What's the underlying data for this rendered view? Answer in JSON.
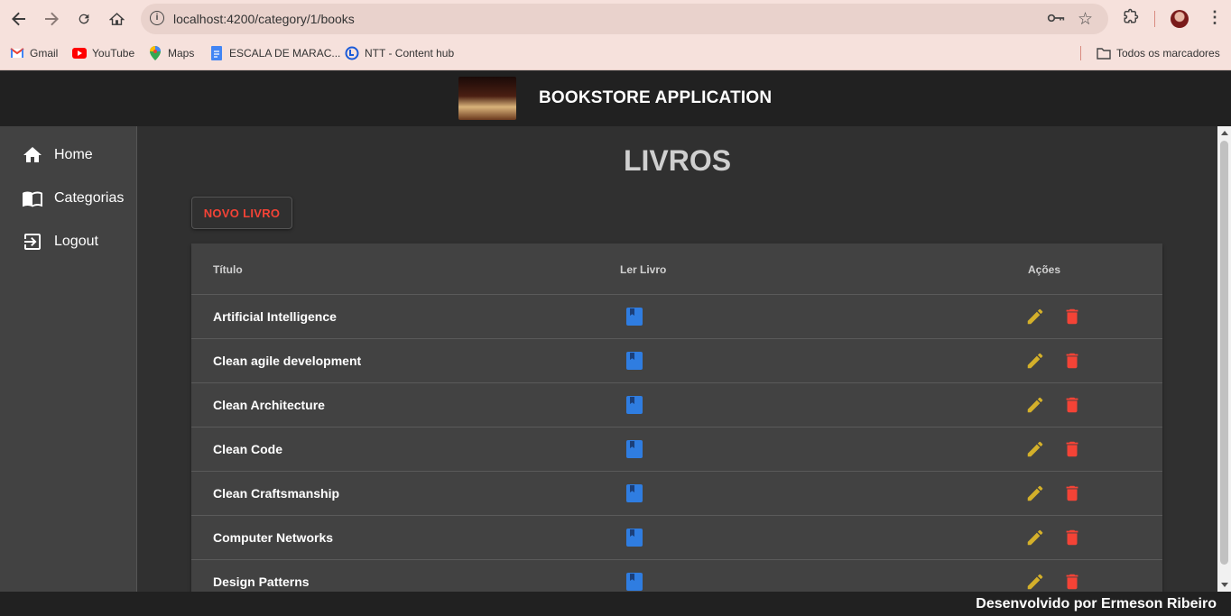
{
  "browser": {
    "url": "localhost:4200/category/1/books",
    "bookmarks": [
      {
        "label": "Gmail",
        "icon": "gmail-icon"
      },
      {
        "label": "YouTube",
        "icon": "youtube-icon"
      },
      {
        "label": "Maps",
        "icon": "maps-icon"
      },
      {
        "label": "ESCALA DE MARAC...",
        "icon": "docs-icon"
      },
      {
        "label": "NTT - Content hub",
        "icon": "ntt-icon"
      }
    ],
    "all_bookmarks_label": "Todos os marcadores"
  },
  "header": {
    "title": "BOOKSTORE APPLICATION"
  },
  "sidebar": {
    "items": [
      {
        "label": "Home",
        "icon": "home-icon"
      },
      {
        "label": "Categorias",
        "icon": "book-open-icon"
      },
      {
        "label": "Logout",
        "icon": "logout-icon"
      }
    ]
  },
  "main": {
    "title": "LIVROS",
    "new_button_label": "NOVO LIVRO",
    "table": {
      "headers": {
        "title": "Título",
        "read": "Ler Livro",
        "actions": "Ações"
      },
      "rows": [
        {
          "title": "Artificial Intelligence"
        },
        {
          "title": "Clean agile development"
        },
        {
          "title": "Clean Architecture"
        },
        {
          "title": "Clean Code"
        },
        {
          "title": "Clean Craftsmanship"
        },
        {
          "title": "Computer Networks"
        },
        {
          "title": "Design Patterns"
        }
      ]
    }
  },
  "footer": {
    "text": "Desenvolvido por Ermeson Ribeiro"
  },
  "colors": {
    "accent_red": "#f44336",
    "book_blue": "#2f7de1",
    "edit_yellow": "#d4b02a",
    "header_bg": "#212121",
    "sidebar_bg": "#424242"
  }
}
